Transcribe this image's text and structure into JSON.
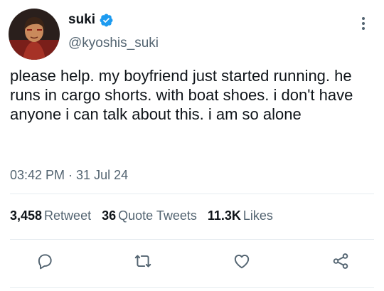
{
  "tweet": {
    "display_name": "suki",
    "handle": "@kyoshis_suki",
    "text": "please help. my boyfriend just started running. he runs in cargo shorts. with boat shoes. i don't have anyone i can talk about this. i am so alone",
    "timestamp": "03:42 PM · 31 Jul 24"
  },
  "stats": {
    "retweets_count": "3,458",
    "retweets_label": "Retweet",
    "quotes_count": "36",
    "quotes_label": "Quote Tweets",
    "likes_count": "11.3K",
    "likes_label": "Likes"
  },
  "actions": [
    "reply-icon",
    "retweet-icon",
    "like-icon",
    "share-icon"
  ],
  "colors": {
    "verified": "#1d9bf0",
    "secondary_text": "#536471",
    "primary_text": "#0f1419",
    "divider": "#e6ecf0"
  }
}
